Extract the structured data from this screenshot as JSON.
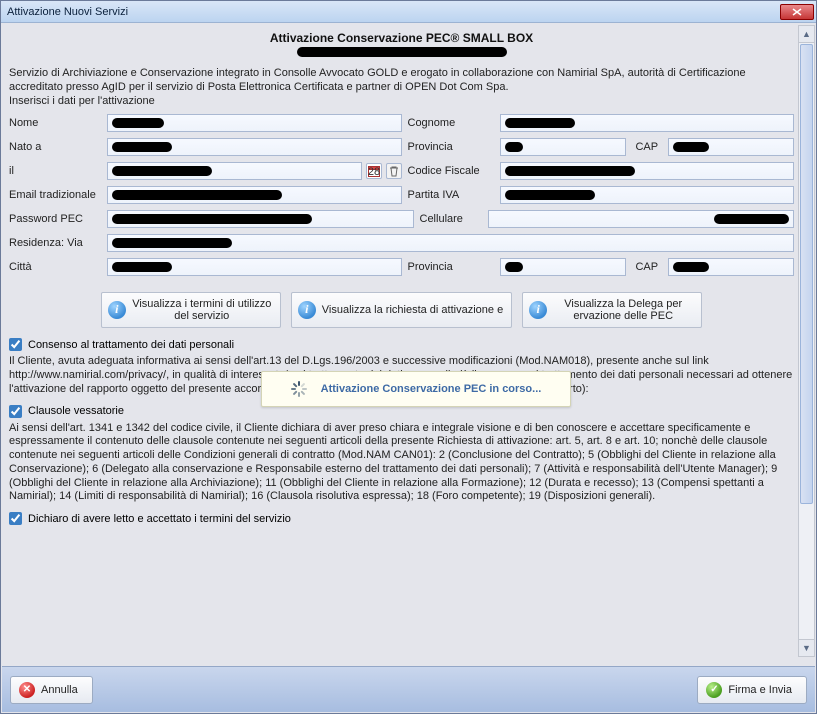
{
  "window_title": "Attivazione Nuovi Servizi",
  "header": {
    "title": "Attivazione Conservazione PEC® SMALL BOX"
  },
  "intro": "Servizio di Archiviazione e Conservazione integrato in Consolle Avvocato GOLD e erogato in collaborazione con Namirial SpA, autorità di Certificazione accreditato presso AgID per il servizio di Posta Elettronica Certificata e partner di OPEN Dot Com Spa.\nInserisci i dati per l'attivazione",
  "form": {
    "nome_label": "Nome",
    "cognome_label": "Cognome",
    "natoa_label": "Nato a",
    "provincia_label": "Provincia",
    "cap_label": "CAP",
    "il_label": "il",
    "cf_label": "Codice Fiscale",
    "email_label": "Email tradizionale",
    "piva_label": "Partita IVA",
    "pwd_label": "Password PEC",
    "cell_label": "Cellulare",
    "res_label": "Residenza: Via",
    "citta_label": "Città"
  },
  "doc_buttons": {
    "b1": "Visualizza i termini di utilizzo del servizio",
    "b2": "Visualizza la richiesta di attivazione e",
    "b3": "Visualizza la Delega per ervazione delle PEC"
  },
  "checkboxes": {
    "consenso": "Consenso al trattamento dei dati personali",
    "clausole": "Clausole vessatorie",
    "dichiaro": "Dichiaro di avere letto e accettato i termini del servizio"
  },
  "para_consenso": "Il Cliente, avuta adeguata informativa ai sensi dell'art.13 del D.Lgs.196/2003 e successive modificazioni (Mod.NAM018), presente anche sul link http://www.namirial.com/privacy/, in qualità di interessato/a al trattamento dei dati personali, dà il consenso al trattamento dei dati personali necessari ad ottenere l'attivazione del rapporto oggetto del presente accordo (conferimento obbligatorio ai fini dell'instaurazione del rapporto):",
  "para_clausole": "Ai sensi dell'art. 1341 e 1342 del codice civile, il Cliente dichiara di aver preso chiara e integrale visione e di ben conoscere e accettare specificamente e espressamente il contenuto delle clausole contenute nei seguenti articoli della presente Richiesta di attivazione: art. 5, art. 8 e art. 10; nonchè delle clausole contenute nei seguenti articoli delle Condizioni generali di contratto (Mod.NAM CAN01): 2 (Conclusione del Contratto); 5 (Obblighi del Cliente in relazione alla Conservazione); 6 (Delegato alla conservazione e Responsabile esterno del trattamento dei dati personali); 7 (Attività e responsabilità dell'Utente Manager); 9 (Obblighi del Cliente in relazione alla Archiviazione); 11 (Obblighi del Cliente in relazione alla Formazione); 12 (Durata e recesso); 13 (Compensi spettanti a Namirial); 14 (Limiti di responsabilità di Namirial); 16 (Clausola risolutiva espressa); 18 (Foro competente); 19 (Disposizioni generali).",
  "modal": "Attivazione Conservazione PEC in corso...",
  "footer": {
    "cancel": "Annulla",
    "submit": "Firma e Invia"
  }
}
